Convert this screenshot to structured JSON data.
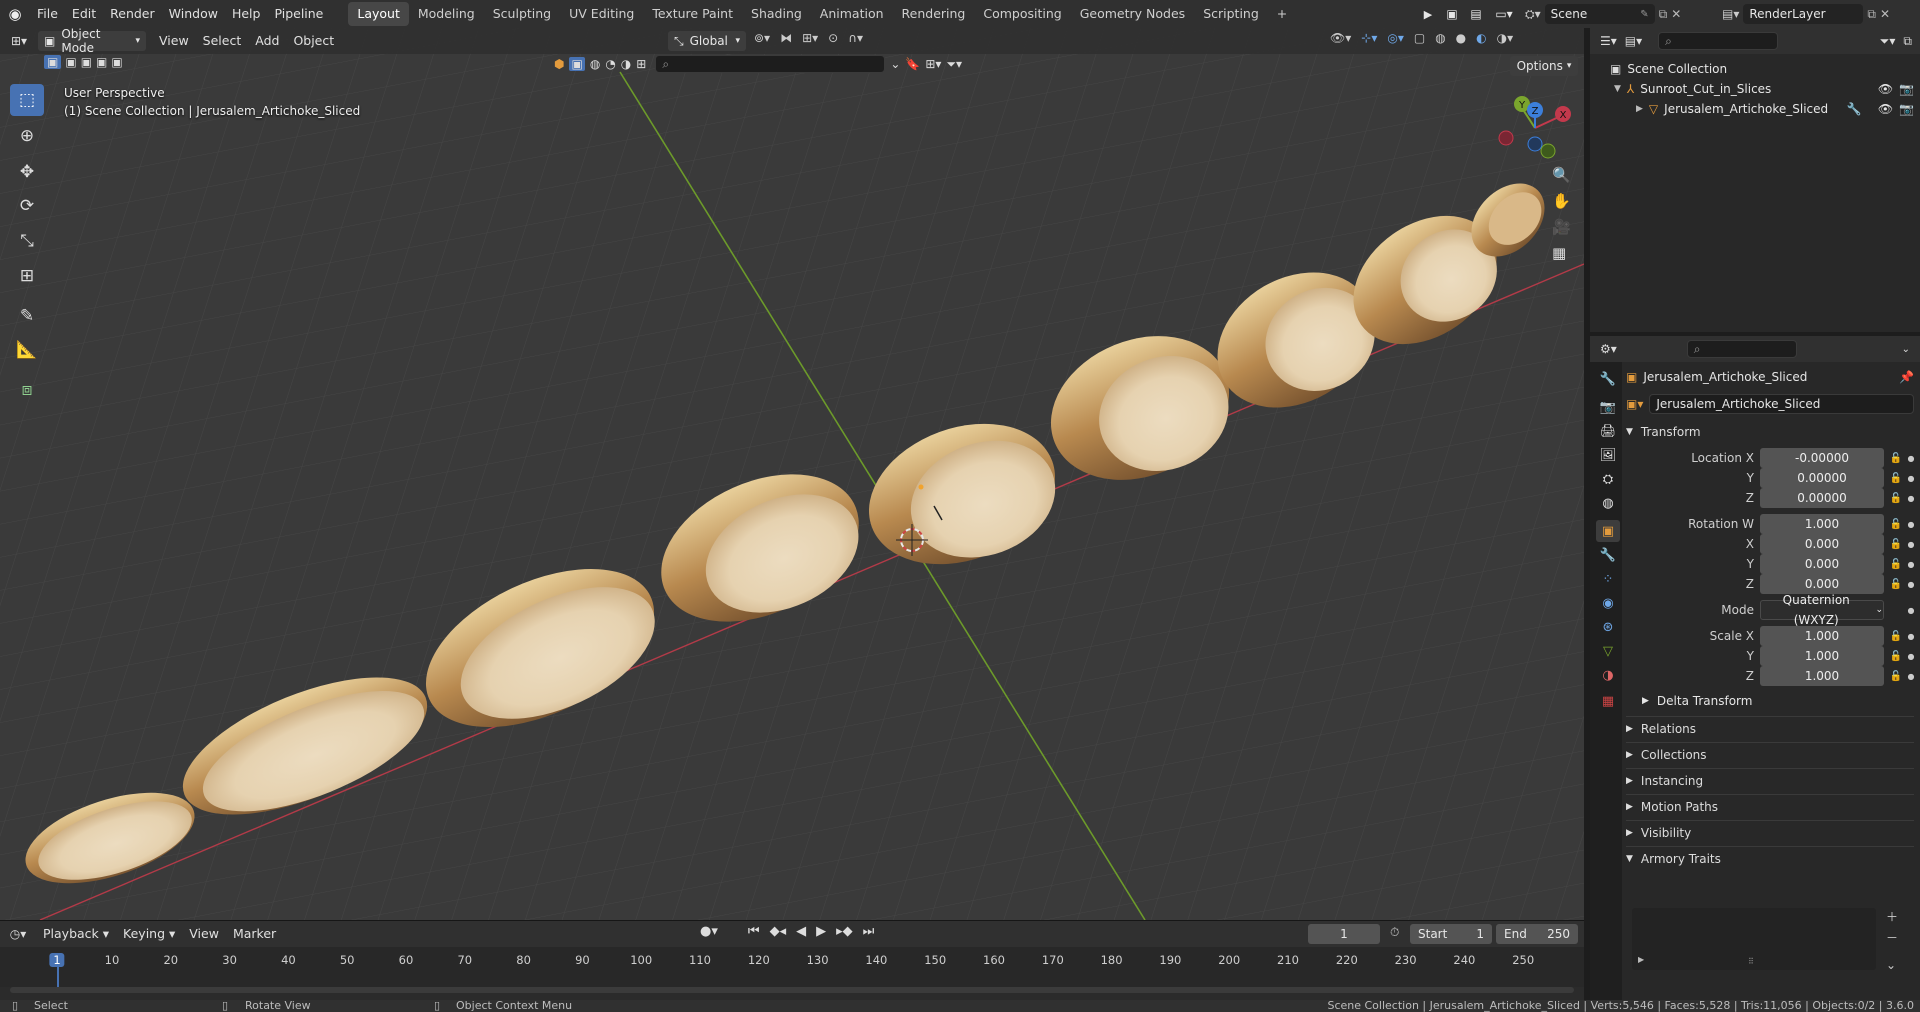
{
  "topbar": {
    "menus": [
      "File",
      "Edit",
      "Render",
      "Window",
      "Help",
      "Pipeline"
    ],
    "workspaces": [
      "Layout",
      "Modeling",
      "Sculpting",
      "UV Editing",
      "Texture Paint",
      "Shading",
      "Animation",
      "Rendering",
      "Compositing",
      "Geometry Nodes",
      "Scripting"
    ],
    "active_workspace": "Layout",
    "add_tab": "+",
    "scene_name": "Scene",
    "view_layer_name": "RenderLayer"
  },
  "viewport_header": {
    "mode": "Object Mode",
    "menus": [
      "View",
      "Select",
      "Add",
      "Object"
    ],
    "transform_orientation": "Global",
    "options_label": "Options"
  },
  "viewport": {
    "view_name": "User Perspective",
    "collection_info": "(1) Scene Collection | Jerusalem_Artichoke_Sliced",
    "gizmo_axes": {
      "x": "X",
      "y": "Y",
      "z": "Z"
    },
    "accent_colors": {
      "x_axis": "#c3394c",
      "y_axis": "#7aa52d",
      "z_axis": "#3c7fdb",
      "active_tool": "#4772b3"
    }
  },
  "outliner": {
    "root": "Scene Collection",
    "collection": "Sunroot_Cut_in_Slices",
    "object": "Jerusalem_Artichoke_Sliced"
  },
  "properties": {
    "object_name": "Jerusalem_Artichoke_Sliced",
    "datablock_name": "Jerusalem_Artichoke_Sliced",
    "transform_header": "Transform",
    "location_label": "Location X",
    "axis_y": "Y",
    "axis_z": "Z",
    "axis_x": "X",
    "location": [
      "-0.00000",
      "0.00000",
      "0.00000"
    ],
    "rotation_label": "Rotation W",
    "rotation": [
      "1.000",
      "0.000",
      "0.000",
      "0.000"
    ],
    "mode_label": "Mode",
    "mode_value": "Quaternion (WXYZ)",
    "scale_label": "Scale X",
    "scale": [
      "1.000",
      "1.000",
      "1.000"
    ],
    "delta_transform": "Delta Transform",
    "panels": [
      "Relations",
      "Collections",
      "Instancing",
      "Motion Paths",
      "Visibility",
      "Armory Traits"
    ]
  },
  "timeline": {
    "menus": [
      "Playback",
      "Keying",
      "View",
      "Marker"
    ],
    "current_frame": "1",
    "start_label": "Start",
    "start": "1",
    "end_label": "End",
    "end": "250",
    "ruler": [
      "1",
      "10",
      "20",
      "30",
      "40",
      "50",
      "60",
      "70",
      "80",
      "90",
      "100",
      "110",
      "120",
      "130",
      "140",
      "150",
      "160",
      "170",
      "180",
      "190",
      "200",
      "210",
      "220",
      "230",
      "240",
      "250"
    ]
  },
  "statusbar": {
    "select": "Select",
    "rotate_view": "Rotate View",
    "context_menu": "Object Context Menu",
    "stats": "Scene Collection | Jerusalem_Artichoke_Sliced | Verts:5,546 | Faces:5,528 | Tris:11,056 | Objects:0/2 | 3.6.0"
  }
}
